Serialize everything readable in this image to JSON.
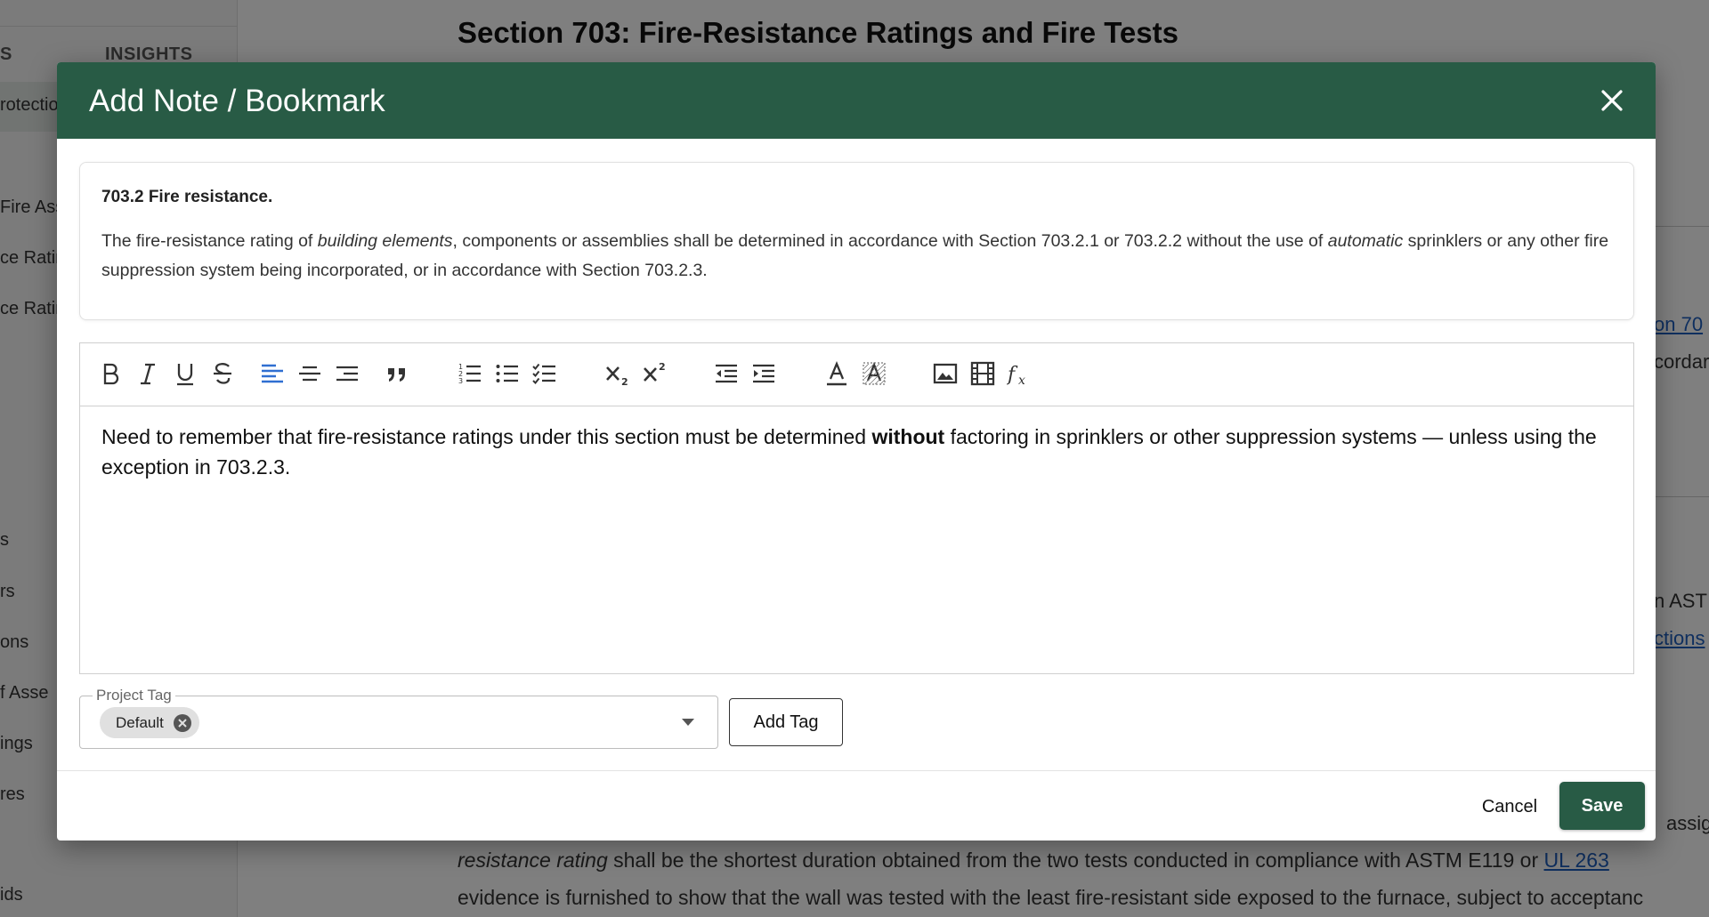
{
  "background": {
    "sidebar": {
      "tab_cut": "S",
      "tab_insights": "INSIGHTS",
      "items": [
        "rotectio",
        "Fire Ass",
        "ce Ratin",
        "ce Ratin",
        "s",
        "rs",
        "ons",
        "f Asse",
        "ings",
        "res",
        "ids"
      ]
    },
    "main_title": "Section 703: Fire-Resistance Ratings and Fire Tests",
    "right_fragments": [
      "on 70",
      "cordar",
      "n AST",
      "ctions"
    ],
    "body_lines": {
      "line1_end": "assig",
      "line2_italic": "resistance rating",
      "line2_rest": " shall be the shortest duration obtained from the two tests conducted in compliance with ASTM E119 or ",
      "line2_link": "UL 263",
      "line3": "evidence is furnished to show that the wall was tested with the least fire-resistant side exposed to the furnace, subject to acceptanc"
    }
  },
  "modal": {
    "title": "Add Note / Bookmark",
    "excerpt": {
      "heading": "703.2 Fire resistance.",
      "part1": "The fire-resistance rating of ",
      "italic1": "building elements",
      "part2": ", components or assemblies shall be determined in accordance with Section 703.2.1 or 703.2.2 without the use of ",
      "italic2": "automatic",
      "part3": " sprinklers or any other fire suppression system being incorporated, or in accordance with Section 703.2.3."
    },
    "toolbar": {
      "tools": [
        "bold",
        "italic",
        "underline",
        "strikethrough",
        "align-left",
        "align-center",
        "align-right",
        "blockquote",
        "ordered-list",
        "bullet-list",
        "checklist",
        "subscript",
        "superscript",
        "outdent",
        "indent",
        "font-color",
        "highlight",
        "image",
        "video",
        "formula"
      ]
    },
    "note": {
      "part1": "Need to remember that fire-resistance ratings under this section must be determined ",
      "bold": "without",
      "part2": " factoring in sprinklers or other suppression systems — unless using the exception in 703.2.3."
    },
    "tag_field": {
      "legend": "Project Tag",
      "chip": "Default"
    },
    "add_tag_label": "Add Tag",
    "cancel_label": "Cancel",
    "save_label": "Save"
  },
  "colors": {
    "brand_green": "#285b45",
    "active_tool": "#2f6fd1",
    "link": "#1f5fbf"
  }
}
